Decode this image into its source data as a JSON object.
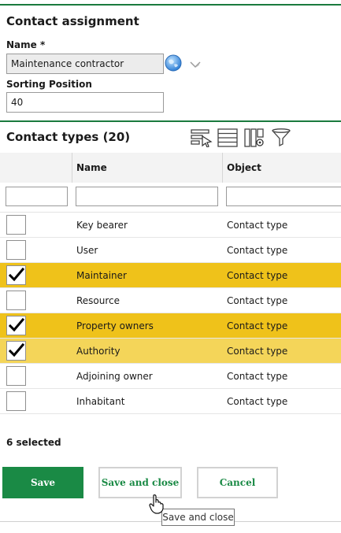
{
  "assignment": {
    "title": "Contact assignment",
    "name_label": "Name *",
    "name_value": "Maintenance contractor",
    "sort_label": "Sorting Position",
    "sort_value": "40",
    "globe_icon": "globe-icon",
    "dropdown_icon": "chevron-down-icon"
  },
  "contact_types": {
    "title": "Contact types (20)",
    "toolbar_icons": [
      "filter-select-icon",
      "rows-icon",
      "column-settings-icon",
      "funnel-icon"
    ],
    "columns": [
      "",
      "Name",
      "Object"
    ],
    "rows": [
      {
        "checked": false,
        "state": "none",
        "name": "Key bearer",
        "object": "Contact type"
      },
      {
        "checked": false,
        "state": "none",
        "name": "User",
        "object": "Contact type"
      },
      {
        "checked": true,
        "state": "selected",
        "name": "Maintainer",
        "object": "Contact type"
      },
      {
        "checked": false,
        "state": "none",
        "name": "Resource",
        "object": "Contact type"
      },
      {
        "checked": true,
        "state": "selected",
        "name": "Property owners",
        "object": "Contact type"
      },
      {
        "checked": true,
        "state": "hover",
        "name": "Authority",
        "object": "Contact type"
      },
      {
        "checked": false,
        "state": "none",
        "name": "Adjoining owner",
        "object": "Contact type"
      },
      {
        "checked": false,
        "state": "none",
        "name": "Inhabitant",
        "object": "Contact type"
      }
    ],
    "selected_count": "6 selected"
  },
  "buttons": {
    "save": "Save",
    "save_close": "Save and close",
    "cancel": "Cancel"
  },
  "tooltip": "Save and close",
  "colors": {
    "accent_green": "#1a8a45",
    "selected_row": "#efc21a",
    "hover_row": "#f4d559"
  }
}
